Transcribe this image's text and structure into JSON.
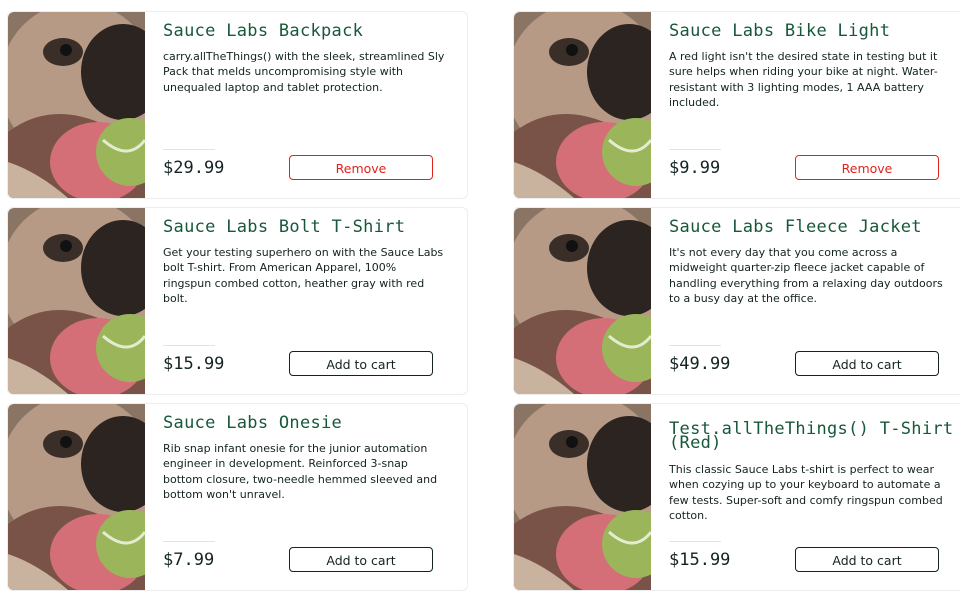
{
  "inventory": {
    "items": [
      {
        "name": "Sauce Labs Backpack",
        "description": "carry.allTheThings() with the sleek, streamlined Sly Pack that melds uncompromising style with unequaled laptop and tablet protection.",
        "price": "$29.99",
        "button_label": "Remove",
        "button_type": "remove"
      },
      {
        "name": "Sauce Labs Bike Light",
        "description": "A red light isn't the desired state in testing but it sure helps when riding your bike at night. Water-resistant with 3 lighting modes, 1 AAA battery included.",
        "price": "$9.99",
        "button_label": "Remove",
        "button_type": "remove"
      },
      {
        "name": "Sauce Labs Bolt T-Shirt",
        "description": "Get your testing superhero on with the Sauce Labs bolt T-shirt. From American Apparel, 100% ringspun combed cotton, heather gray with red bolt.",
        "price": "$15.99",
        "button_label": "Add to cart",
        "button_type": "add"
      },
      {
        "name": "Sauce Labs Fleece Jacket",
        "description": "It's not every day that you come across a midweight quarter-zip fleece jacket capable of handling everything from a relaxing day outdoors to a busy day at the office.",
        "price": "$49.99",
        "button_label": "Add to cart",
        "button_type": "add"
      },
      {
        "name": "Sauce Labs Onesie",
        "description": "Rib snap infant onesie for the junior automation engineer in development. Reinforced 3-snap bottom closure, two-needle hemmed sleeved and bottom won't unravel.",
        "price": "$7.99",
        "button_label": "Add to cart",
        "button_type": "add"
      },
      {
        "name": "Test.allTheThings() T-Shirt (Red)",
        "description": "This classic Sauce Labs t-shirt is perfect to wear when cozying up to your keyboard to automate a few tests. Super-soft and comfy ringspun combed cotton.",
        "price": "$15.99",
        "button_label": "Add to cart",
        "button_type": "add"
      }
    ]
  },
  "colors": {
    "name_green": "#18583a",
    "remove_red": "#e2231a",
    "text_dark": "#132322"
  }
}
